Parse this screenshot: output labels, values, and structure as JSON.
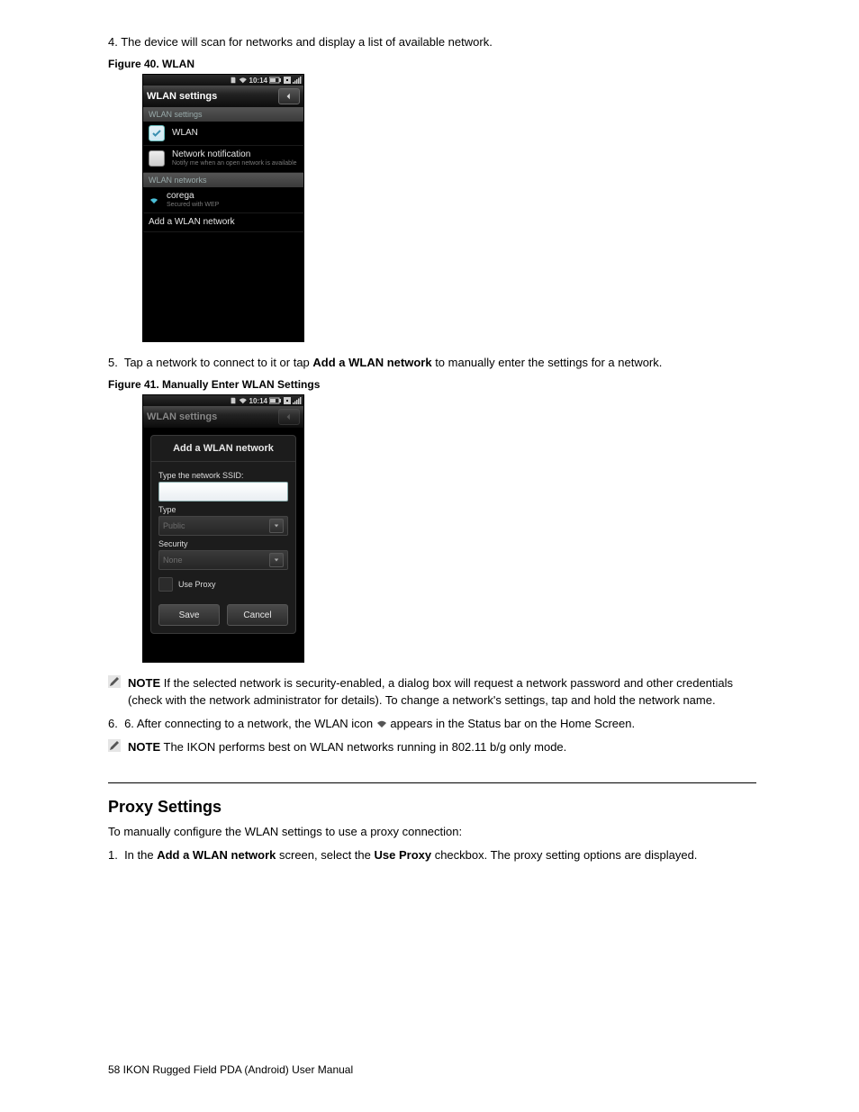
{
  "intro_line4": "4. The device will scan for networks and display a list of available network.",
  "figcap1": "Figure 40. WLAN",
  "phone1": {
    "status_time": "10:14",
    "header_title": "WLAN settings",
    "section1": "WLAN settings",
    "row_wlan_title": "WLAN",
    "row_notif_title": "Network notification",
    "row_notif_sub": "Notify me when an open network is available",
    "section2": "WLAN networks",
    "row_net_title": "corega",
    "row_net_sub": "Secured with WEP",
    "row_add": "Add a WLAN network"
  },
  "intro_line5": "5. Tap a network to connect to it or tap Add a WLAN network to manually enter the settings for a network.",
  "figcap2": "Figure 41. Manually Enter WLAN Settings",
  "phone2": {
    "status_time": "10:14",
    "header_title": "WLAN settings",
    "dlg_title": "Add a WLAN network",
    "lbl_ssid": "Type the network SSID:",
    "lbl_type": "Type",
    "sel_type_value": "Public",
    "lbl_security": "Security",
    "sel_security_value": "None",
    "cb_proxy": "Use Proxy",
    "btn_save": "Save",
    "btn_cancel": "Cancel"
  },
  "note_label": "NOTE",
  "note_text": "If the selected network is security-enabled, a dialog box will request a network password and other credentials (check with the network administrator for details). To change a network's settings, tap and hold the network name.",
  "intro_line6_a": "6. After connecting to a network, the WLAN icon ",
  "intro_line6_b": " appears in the Status bar on the Home Screen.",
  "intro_line6_note": "The IKON performs best on WLAN networks running in 802.11 b/g only mode.",
  "proxy_title": "Proxy Settings",
  "proxy_body_1": "To manually configure the WLAN settings to use a proxy connection:",
  "proxy_step1": "1. In the Add a WLAN network screen, select the Use Proxy checkbox. The proxy setting options are displayed.",
  "footer_text": "58  IKON Rugged Field PDA (Android) User Manual"
}
